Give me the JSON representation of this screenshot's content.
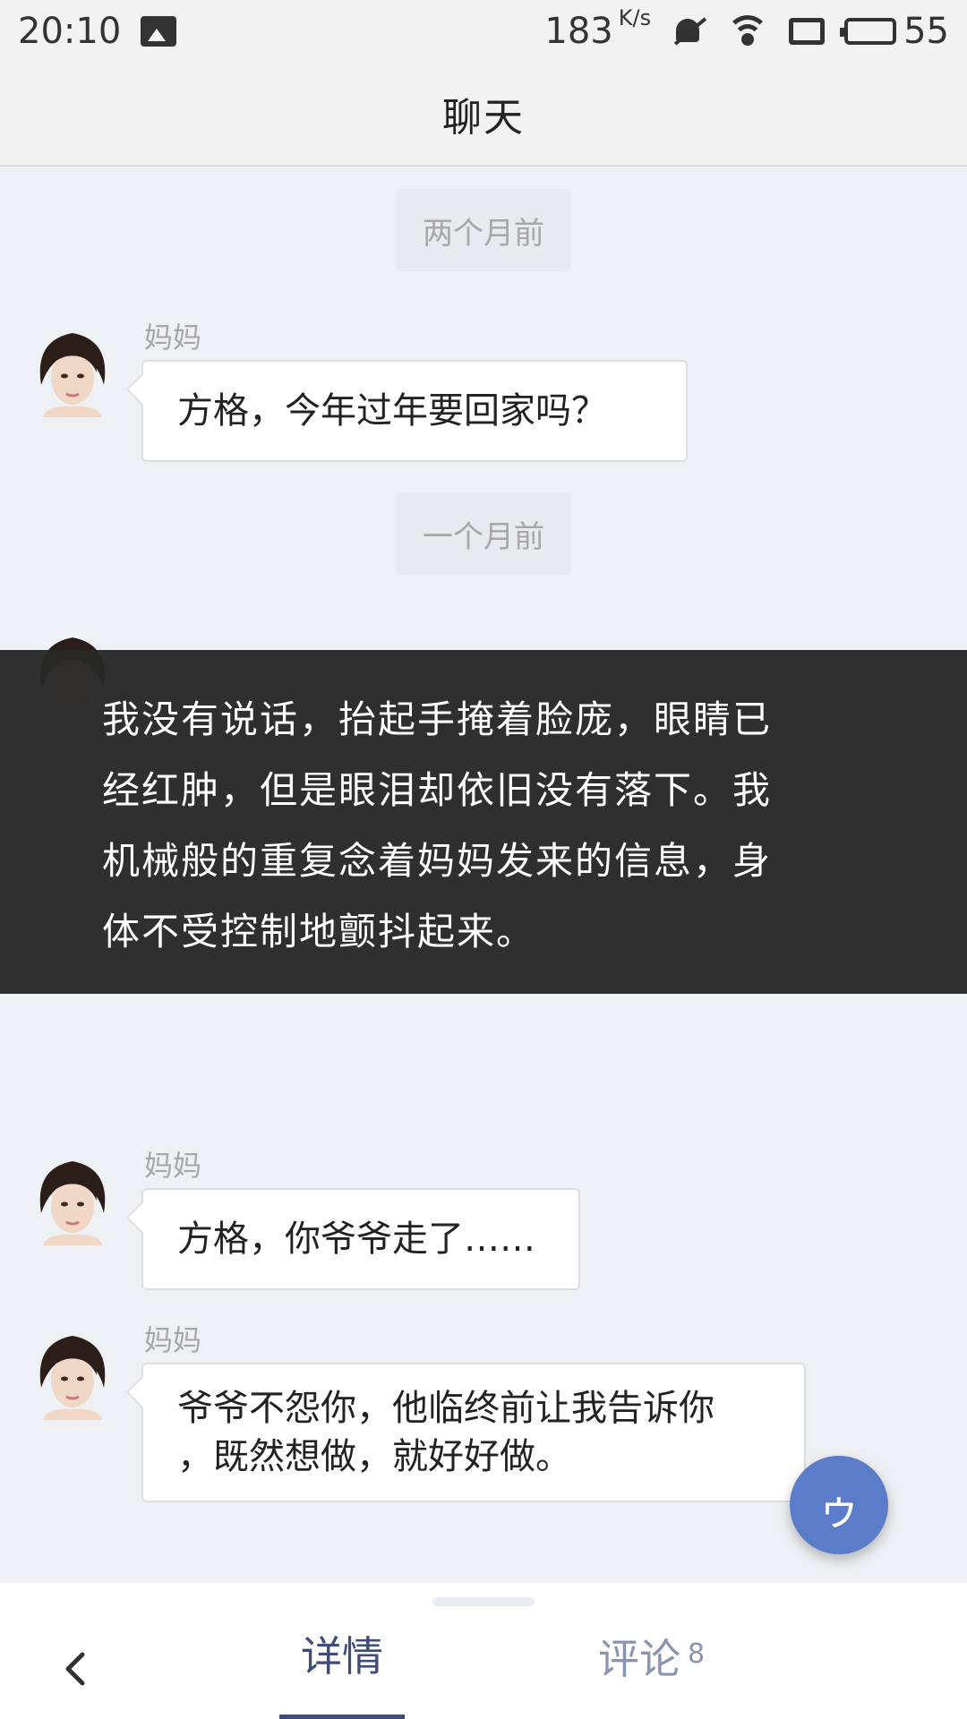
{
  "status_bar": {
    "time": "20:10",
    "speed_value": "183",
    "speed_unit": "K/s",
    "battery_level": "55",
    "icons": [
      "image-icon",
      "bell-muted-icon",
      "wifi-icon",
      "sim-icon",
      "battery-icon"
    ]
  },
  "header": {
    "title": "聊天"
  },
  "chat": {
    "time_labels": [
      "两个月前",
      "一个月前"
    ],
    "messages": [
      {
        "sender": "妈妈",
        "text": "方格，今年过年要回家吗？"
      },
      {
        "sender": "妈妈",
        "text": "方格，你爷爷走了……"
      },
      {
        "sender": "妈妈",
        "text": "爷爷不怨你，他临终前让我告诉你，既然想做，就好好做。",
        "line1": "爷爷不怨你，他临终前让我告诉你",
        "line2": "，既然想做，就好好做。"
      }
    ]
  },
  "narration": {
    "text": "我没有说话，抬起手掩着脸庞，眼睛已经红肿，但是眼泪却依旧没有落下。我机械般的重复念着妈妈发来的信息，身体不受控制地颤抖起来。",
    "lines": [
      "我没有说话，抬起手掩着脸庞，眼睛已",
      "经红肿，但是眼泪却依旧没有落下。我",
      "机械般的重复念着妈妈发来的信息，身",
      "体不受控制地颤抖起来。"
    ]
  },
  "fab": {
    "label": "ゥ",
    "icon": "next-icon"
  },
  "bottom_bar": {
    "tabs": [
      {
        "label": "详情",
        "active": true
      },
      {
        "label": "评论",
        "count": "8",
        "active": false
      }
    ],
    "back_icon": "chevron-left-icon"
  },
  "colors": {
    "accent": "#3d4c7a",
    "fab": "#5b7cc8",
    "background": "#eff0f3",
    "overlay": "#282828"
  }
}
